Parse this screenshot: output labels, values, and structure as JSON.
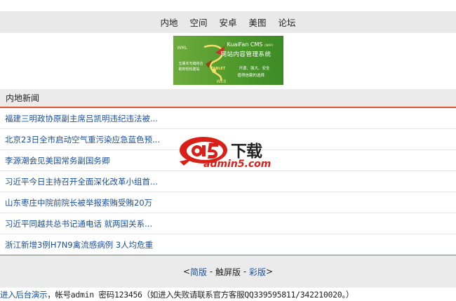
{
  "nav": {
    "items": [
      "内地",
      "空间",
      "安卓",
      "美图",
      "论坛"
    ]
  },
  "banner": {
    "wml": "WML",
    "tablet": "TABLET",
    "web": "WEB",
    "cms_en": "KuaiFan CMS",
    "cms_en_tag": "(WAP)",
    "cms_cn": "网站内容管理系统",
    "slogan_1": "开源、强大、安全",
    "slogan_2": "值得信赖的选择",
    "left_text_1": "五版本无缝结合",
    "left_text_2": "助你轻松建站",
    "colors": {
      "green": "#4f9a2b",
      "accent": "#f4e06a"
    }
  },
  "section": {
    "title": "内地新闻"
  },
  "news": [
    "福建三明政协原副主席吕凯明违纪违法被...",
    "北京23日全市启动空气重污染应急蓝色预...",
    "李源潮会见美国常务副国务卿",
    "习近平今日主持召开全面深化改革小组首...",
    "山东枣庄中院前院长被举报索贿受贿20万",
    "习近平同越共总书记通电话 就两国关系...",
    "浙江新增3例H7N9禽流感病例 3人均危重"
  ],
  "watermark": {
    "cn": "下载",
    "en": "admin5.com",
    "icon": "a5-logo-icon"
  },
  "footer": {
    "open": "<",
    "simple": "简版",
    "sep1": " - ",
    "touch": "触屏版",
    "sep2": " - ",
    "color": "彩版",
    "close": ">"
  },
  "note": {
    "link": "进入后台演示",
    "text": "，帐号admin 密码123456（如进入失败请联系官方客服QQ339595811/342210020。）"
  },
  "colors": {
    "link": "#1a4f9a",
    "accent_line": "#e3542b",
    "bar_bg": "#ebebeb"
  }
}
